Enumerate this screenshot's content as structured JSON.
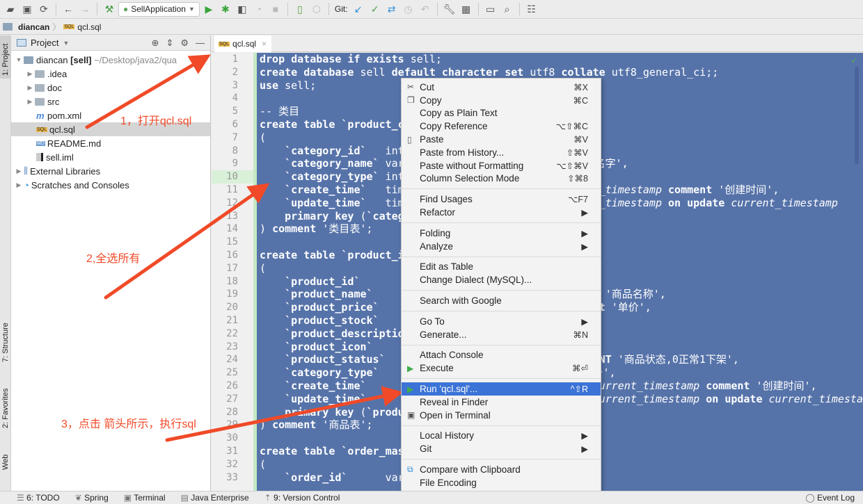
{
  "toolbar": {
    "run_config": "SellApplication",
    "git_label": "Git:"
  },
  "breadcrumb": {
    "project": "diancan",
    "file": "qcl.sql"
  },
  "left_strip": {
    "tabs": [
      "1: Project",
      "7: Structure",
      "2: Favorites",
      "Web"
    ]
  },
  "project_panel": {
    "title": "Project",
    "root_name": "diancan",
    "root_module": "[sell]",
    "root_path": "~/Desktop/java2/qua",
    "items": [
      {
        "label": ".idea",
        "type": "folder"
      },
      {
        "label": "doc",
        "type": "folder"
      },
      {
        "label": "src",
        "type": "folder"
      },
      {
        "label": "pom.xml",
        "type": "maven"
      },
      {
        "label": "qcl.sql",
        "type": "sql"
      },
      {
        "label": "README.md",
        "type": "md"
      },
      {
        "label": "sell.iml",
        "type": "iml"
      }
    ],
    "external_libraries": "External Libraries",
    "scratches": "Scratches and Consoles"
  },
  "editor": {
    "tab_label": "qcl.sql",
    "line_numbers": [
      "1",
      "2",
      "3",
      "4",
      "5",
      "6",
      "7",
      "8",
      "9",
      "10",
      "11",
      "12",
      "13",
      "14",
      "15",
      "16",
      "17",
      "18",
      "19",
      "20",
      "21",
      "22",
      "23",
      "24",
      "25",
      "26",
      "27",
      "28",
      "29",
      "30",
      "31",
      "32",
      "33"
    ],
    "lines": [
      "drop database if exists sell;",
      "create database sell default character set utf8 collate utf8_general_ci;;",
      "use sell;",
      "",
      "-- 类目",
      "create table `product_category` (",
      "(",
      "    `category_id`   int not null auto_increment,",
      "    `category_name` varchar(64) not null comment '类目名字',",
      "    `category_type` int not null comment '类目编号',",
      "    `create_time`   timestamp not null default current_timestamp comment '创建时间',",
      "    `update_time`   timestamp not null default current_timestamp on update current_timestamp",
      "    primary key (`category_id`)",
      ") comment '类目表';",
      "",
      "create table `product_info` (",
      "(",
      "    `product_id`          varchar(32) not null,",
      "    `product_name`        varchar(64) not null comment '商品名称',",
      "    `product_price`       decimal(8,2) not null comment '单价',",
      "    `product_stock`       int not null comment '库存',",
      "    `product_description` varchar(64) comment '描述',",
      "    `product_icon`        varchar(512) comment '小图',",
      "    `product_status`      tinyint(3) DEFAULT '0' COMMENT '商品状态,0正常1下架',",
      "    `category_type`       int not null comment '类目编号',",
      "    `create_time`         timestamp not null default current_timestamp comment '创建时间',",
      "    `update_time`         timestamp not null default current_timestamp on update current_timestamp",
      "    primary key (`product_id`)",
      ") comment '商品表';",
      "",
      "create table `order_master` (",
      "(",
      "    `order_id`      varchar(32) not null,"
    ]
  },
  "context_menu": {
    "groups": [
      [
        {
          "label": "Cut",
          "shortcut": "⌘X",
          "icon": "scissors-icon"
        },
        {
          "label": "Copy",
          "shortcut": "⌘C",
          "icon": "copy-icon"
        },
        {
          "label": "Copy as Plain Text",
          "shortcut": ""
        },
        {
          "label": "Copy Reference",
          "shortcut": "⌥⇧⌘C"
        },
        {
          "label": "Paste",
          "shortcut": "⌘V",
          "icon": "paste-icon"
        },
        {
          "label": "Paste from History...",
          "shortcut": "⇧⌘V"
        },
        {
          "label": "Paste without Formatting",
          "shortcut": "⌥⇧⌘V"
        },
        {
          "label": "Column Selection Mode",
          "shortcut": "⇧⌘8"
        }
      ],
      [
        {
          "label": "Find Usages",
          "shortcut": "⌥F7"
        },
        {
          "label": "Refactor",
          "shortcut": "▶"
        }
      ],
      [
        {
          "label": "Folding",
          "shortcut": "▶"
        },
        {
          "label": "Analyze",
          "shortcut": "▶"
        }
      ],
      [
        {
          "label": "Edit as Table",
          "shortcut": ""
        },
        {
          "label": "Change Dialect (MySQL)...",
          "shortcut": ""
        }
      ],
      [
        {
          "label": "Search with Google",
          "shortcut": ""
        }
      ],
      [
        {
          "label": "Go To",
          "shortcut": "▶"
        },
        {
          "label": "Generate...",
          "shortcut": "⌘N"
        }
      ],
      [
        {
          "label": "Attach Console",
          "shortcut": ""
        },
        {
          "label": "Execute",
          "shortcut": "⌘⏎",
          "icon": "run-icon"
        }
      ],
      [
        {
          "label": "Run 'qcl.sql'...",
          "shortcut": "^⇧R",
          "icon": "run-icon",
          "active": true
        },
        {
          "label": "Reveal in Finder",
          "shortcut": ""
        },
        {
          "label": "Open in Terminal",
          "shortcut": "",
          "icon": "terminal-icon"
        }
      ],
      [
        {
          "label": "Local History",
          "shortcut": "▶"
        },
        {
          "label": "Git",
          "shortcut": "▶"
        }
      ],
      [
        {
          "label": "Compare with Clipboard",
          "shortcut": "",
          "icon": "compare-icon"
        },
        {
          "label": "File Encoding",
          "shortcut": ""
        }
      ]
    ]
  },
  "annotations": {
    "step1": "1，打开qcl.sql",
    "step2": "2,全选所有",
    "step3": "3，点击 箭头所示，执行sql",
    "color": "#f04a28"
  },
  "statusbar": {
    "items": [
      "6: TODO",
      "Spring",
      "Terminal",
      "Java Enterprise",
      "9: Version Control"
    ],
    "event_log": "Event Log"
  },
  "colors": {
    "selection": "#5673a9",
    "menu_active": "#3b73d6"
  }
}
